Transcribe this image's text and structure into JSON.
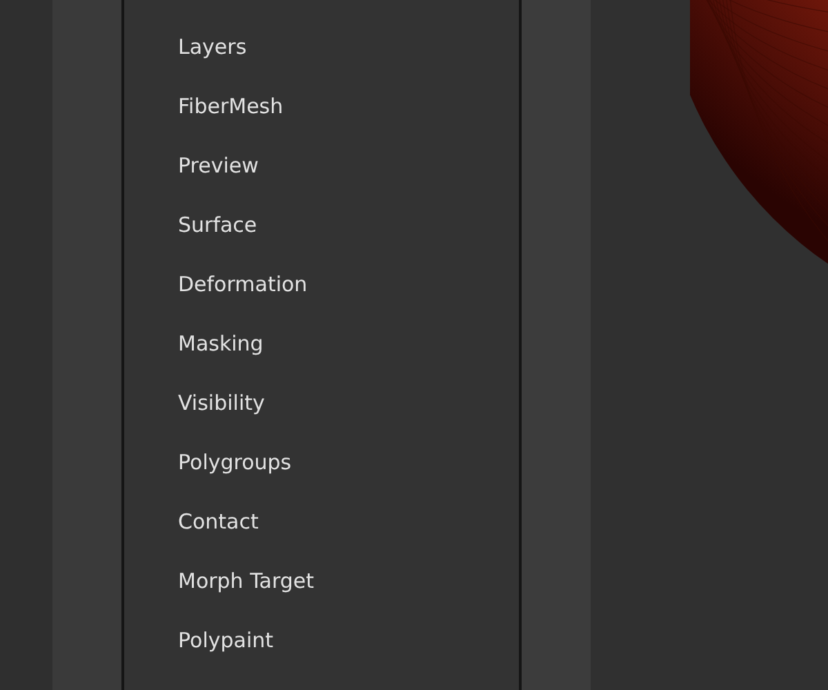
{
  "menu": {
    "items": [
      {
        "label": "Layers"
      },
      {
        "label": "FiberMesh"
      },
      {
        "label": "Preview"
      },
      {
        "label": "Surface"
      },
      {
        "label": "Deformation"
      },
      {
        "label": "Masking"
      },
      {
        "label": "Visibility"
      },
      {
        "label": "Polygroups"
      },
      {
        "label": "Contact"
      },
      {
        "label": "Morph Target"
      },
      {
        "label": "Polypaint"
      }
    ]
  }
}
